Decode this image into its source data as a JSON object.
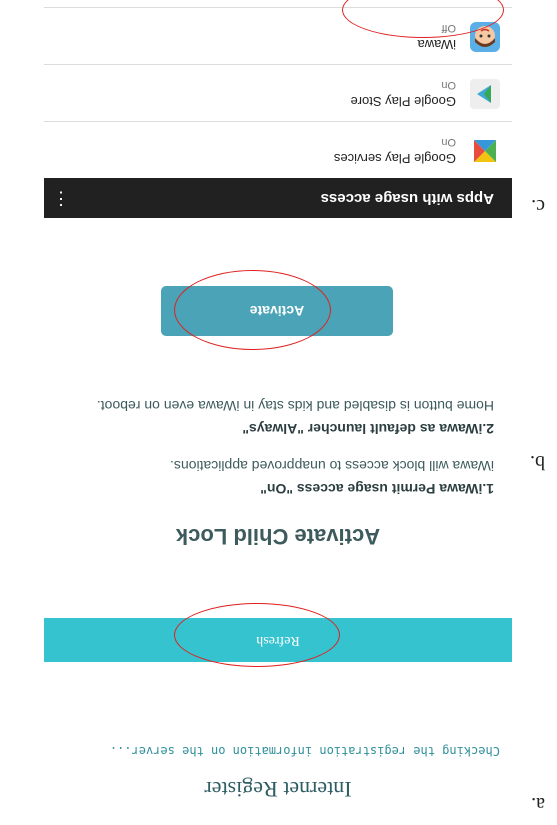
{
  "panel_labels": {
    "a": "a.",
    "b": "b.",
    "c": "c."
  },
  "panel_a": {
    "title": "Internet Register",
    "message": "Checking the registration information on the server...",
    "refresh_label": "Refresh"
  },
  "panel_b": {
    "heading": "Activate Child Lock",
    "step1_title": "1.iWawa Permit usage access \"On\"",
    "step1_body": "iWawa will block access to unapproved applications.",
    "step2_title": "2.iWawa as default launcher \"Always\"",
    "step2_body": "Home button is disabled and kids stay in iWawa even on reboot.",
    "activate_label": "Activate"
  },
  "panel_c": {
    "title": "Apps with usage access",
    "apps": [
      {
        "name": "Google Play services",
        "status": "On",
        "icon": "google-play-services-icon"
      },
      {
        "name": "Google Play Store",
        "status": "On",
        "icon": "google-play-store-icon"
      },
      {
        "name": "iWawa",
        "status": "Off",
        "icon": "iwawa-app-icon"
      }
    ]
  },
  "colors": {
    "refresh_bar": "#34c3cf",
    "activate_button": "#4aa3b6",
    "app_bar": "#212121",
    "highlight_ring": "#e02020"
  }
}
